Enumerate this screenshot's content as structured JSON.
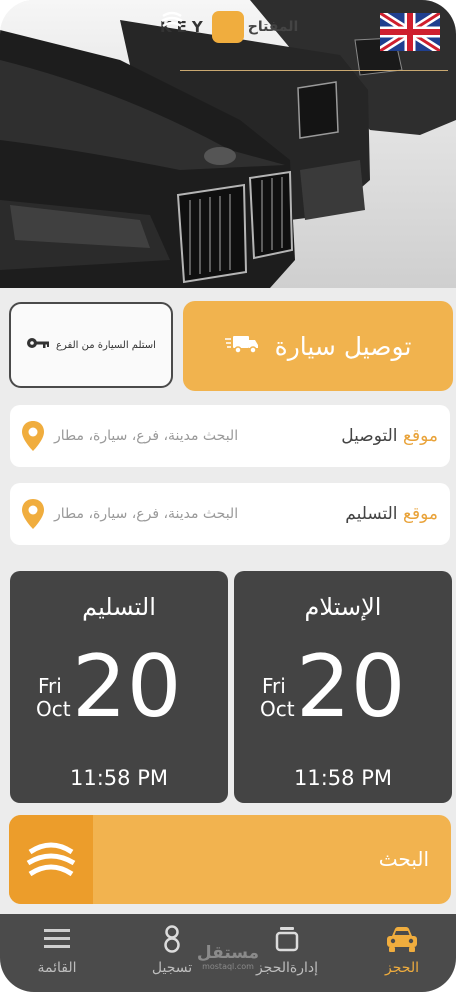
{
  "header": {
    "logo_latin": "KEY",
    "logo_arabic": "المفتاح",
    "language_flag": "uk-flag-icon"
  },
  "service": {
    "pickup_label": "استلم السيارة من الفرع",
    "pickup_icon": "key-icon",
    "delivery_label": "توصيل سيارة",
    "delivery_icon": "delivery-truck-icon"
  },
  "delivery_location": {
    "label_accent": "موقع",
    "label_rest": "التوصيل",
    "placeholder": "البحث مدينة، فرع، سيارة، مطار"
  },
  "return_location": {
    "label_accent": "موقع",
    "label_rest": "التسليم",
    "placeholder": "البحث مدينة، فرع، سيارة، مطار"
  },
  "pickup_date": {
    "title": "الإستلام",
    "day_of_week": "Fri",
    "month": "Oct",
    "day": "20",
    "time": "11:58 PM"
  },
  "return_date": {
    "title": "التسليم",
    "day_of_week": "Fri",
    "month": "Oct",
    "day": "20",
    "time": "11:58 PM"
  },
  "search": {
    "label": "البحث"
  },
  "tabbar": {
    "items": [
      {
        "label": "القائمة",
        "icon": "menu-icon"
      },
      {
        "label": "تسجيل",
        "icon": "register-icon"
      },
      {
        "label": "إدارةالحجز",
        "icon": "manage-booking-icon"
      },
      {
        "label": "الحجز",
        "icon": "car-icon"
      }
    ],
    "watermark_top": "مستقل",
    "watermark_bottom": "mostaql.com"
  },
  "colors": {
    "accent": "#f0ad3e",
    "dark_card": "#444444",
    "tabbar": "#4b4b4b"
  }
}
